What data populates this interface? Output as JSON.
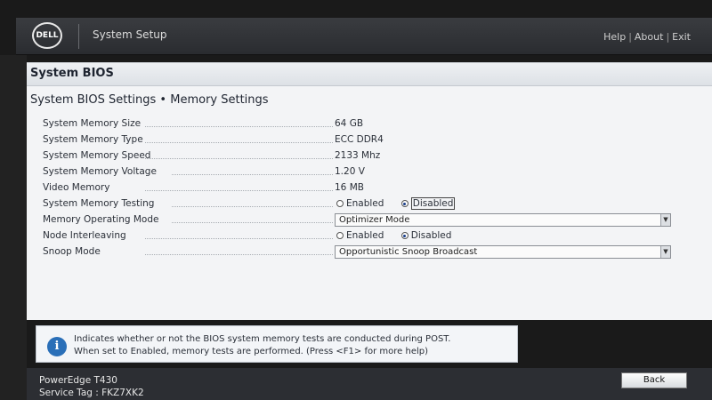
{
  "header": {
    "logo_text": "DELL",
    "title": "System Setup",
    "links": [
      "Help",
      "About",
      "Exit"
    ]
  },
  "panel": {
    "title": "System BIOS",
    "section_title": "System BIOS Settings • Memory Settings"
  },
  "settings": [
    {
      "label": "System Memory Size",
      "value": "64 GB"
    },
    {
      "label": "System Memory Type",
      "value": "ECC DDR4"
    },
    {
      "label": "System Memory Speed",
      "value": "2133 Mhz"
    },
    {
      "label": "System Memory Voltage",
      "value": "1.20 V"
    },
    {
      "label": "Video Memory",
      "value": "16 MB"
    },
    {
      "label": "System Memory Testing",
      "options": [
        "Enabled",
        "Disabled"
      ],
      "selected": "Disabled"
    },
    {
      "label": "Memory Operating Mode",
      "select_value": "Optimizer Mode"
    },
    {
      "label": "Node Interleaving",
      "options": [
        "Enabled",
        "Disabled"
      ],
      "selected": "Disabled"
    },
    {
      "label": "Snoop Mode",
      "select_value": "Opportunistic Snoop Broadcast"
    }
  ],
  "help": {
    "icon": "info-icon",
    "line1": "Indicates whether or not the BIOS system memory tests are conducted during POST.",
    "line2": "When set to Enabled, memory tests are performed. (Press <F1> for more help)"
  },
  "footer": {
    "model": "PowerEdge T430",
    "service_tag": "Service Tag : FKZ7XK2",
    "back_label": "Back"
  }
}
